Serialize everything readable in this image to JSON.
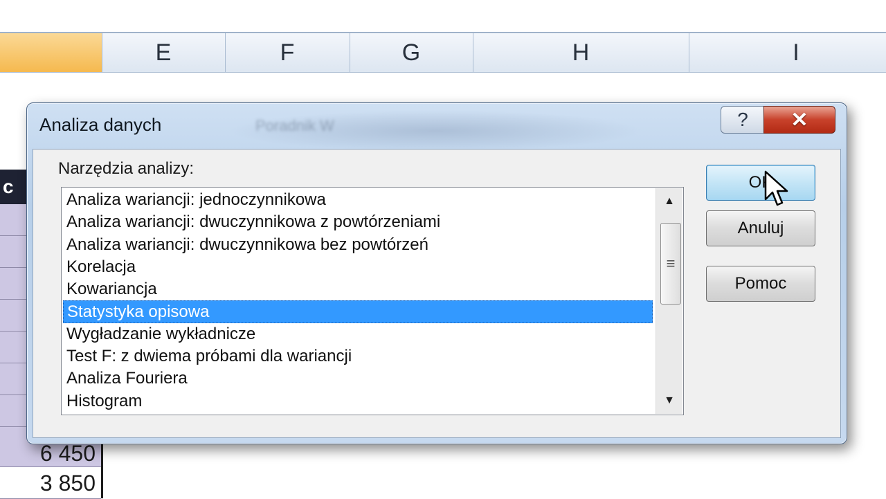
{
  "sheet": {
    "columns": [
      {
        "label": "",
        "selected": true
      },
      {
        "label": "E"
      },
      {
        "label": "F"
      },
      {
        "label": "G"
      },
      {
        "label": "H"
      },
      {
        "label": "I"
      }
    ],
    "partial_header": "c",
    "cells": [
      "6 450",
      "3 850"
    ]
  },
  "dialog": {
    "title": "Analiza danych",
    "ghost_title": "Poradnik W",
    "help_label": "?",
    "close_label": "✕",
    "list_label": "Narzędzia analizy:",
    "items": [
      "Analiza wariancji: jednoczynnikowa",
      "Analiza wariancji: dwuczynnikowa z powtórzeniami",
      "Analiza wariancji: dwuczynnikowa bez powtórzeń",
      "Korelacja",
      "Kowariancja",
      "Statystyka opisowa",
      "Wygładzanie wykładnicze",
      "Test F: z dwiema próbami dla wariancji",
      "Analiza Fouriera",
      "Histogram"
    ],
    "selected_index": 5,
    "buttons": {
      "ok": "OK",
      "cancel": "Anuluj",
      "help": "Pomoc"
    }
  },
  "colors": {
    "selection": "#3399ff",
    "close_button": "#c8422b",
    "selected_column": "#f5b94f"
  }
}
